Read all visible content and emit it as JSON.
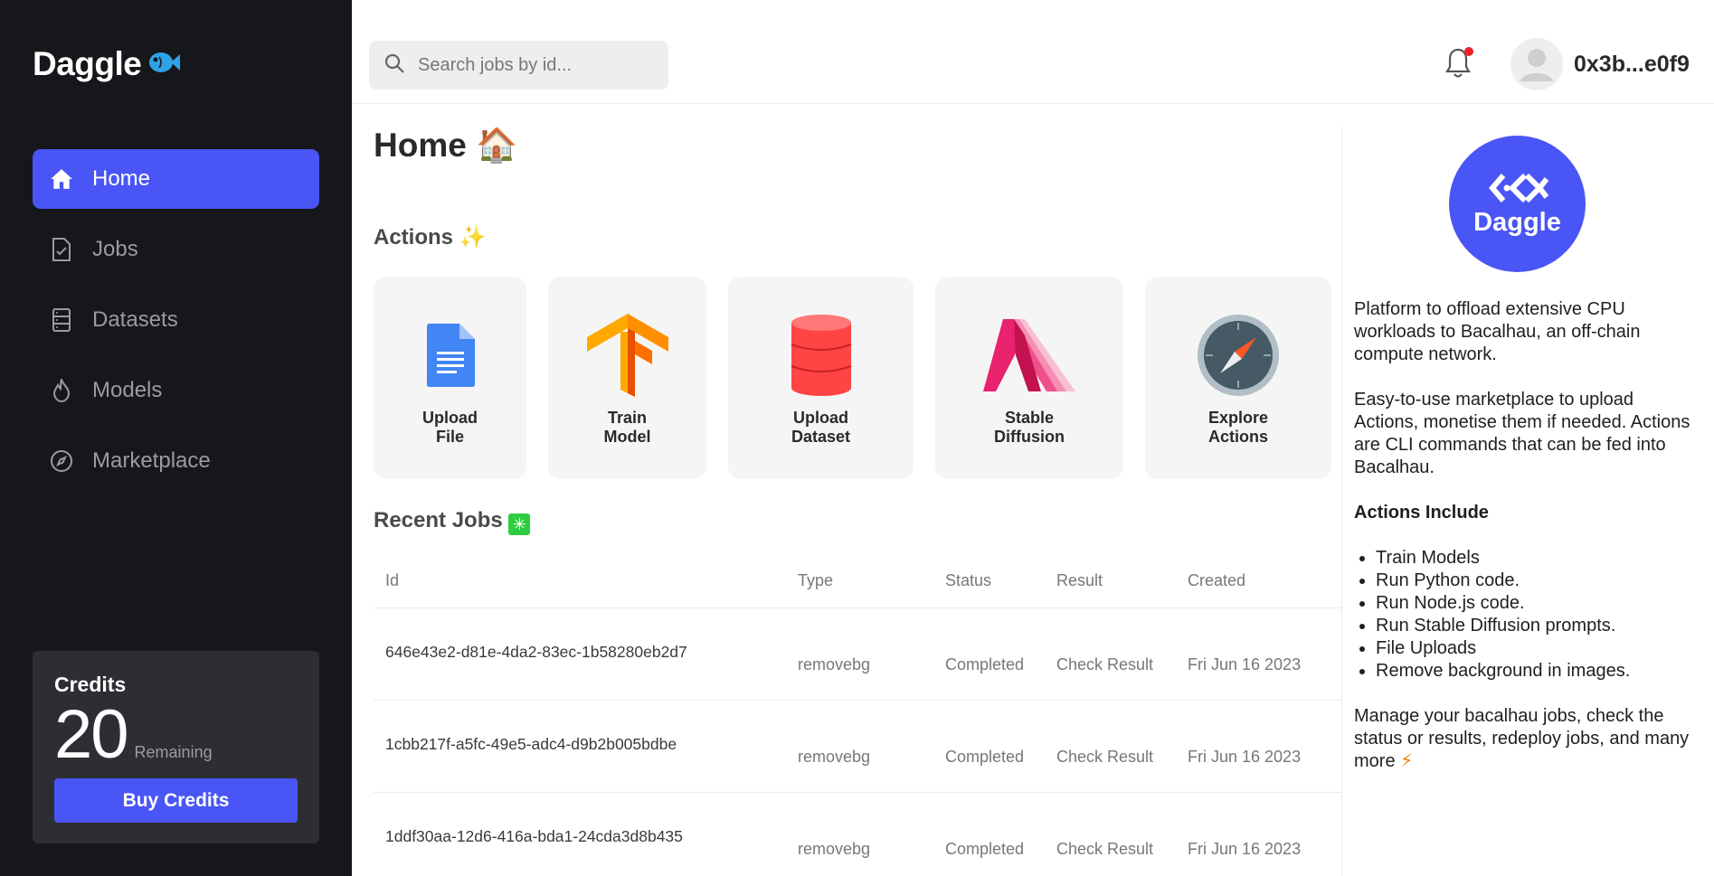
{
  "sidebar": {
    "logo": "Daggle",
    "nav": [
      {
        "label": "Home",
        "icon": "home-icon",
        "active": true
      },
      {
        "label": "Jobs",
        "icon": "file-check-icon",
        "active": false
      },
      {
        "label": "Datasets",
        "icon": "database-icon",
        "active": false
      },
      {
        "label": "Models",
        "icon": "flame-icon",
        "active": false
      },
      {
        "label": "Marketplace",
        "icon": "compass-icon",
        "active": false
      }
    ],
    "credits": {
      "title": "Credits",
      "amount": "20",
      "remaining_label": "Remaining",
      "buy_label": "Buy Credits"
    }
  },
  "header": {
    "search_placeholder": "Search jobs by id...",
    "user_address": "0x3b...e0f9",
    "notification_dot": true
  },
  "main": {
    "title": "Home",
    "title_emoji": "🏠",
    "actions_title": "Actions",
    "actions_emoji": "✨",
    "actions": [
      {
        "line1": "Upload",
        "line2": "File",
        "icon": "google-doc-icon"
      },
      {
        "line1": "Train",
        "line2": "Model",
        "icon": "tensorflow-icon"
      },
      {
        "line1": "Upload",
        "line2": "Dataset",
        "icon": "database-red-icon"
      },
      {
        "line1": "Stable",
        "line2": "Diffusion",
        "icon": "stable-diffusion-icon"
      },
      {
        "line1": "Explore",
        "line2": "Actions",
        "icon": "compass-safari-icon"
      }
    ],
    "recent_title": "Recent Jobs",
    "recent_emoji": "✳",
    "table": {
      "headers": [
        "Id",
        "Type",
        "Status",
        "Result",
        "Created"
      ],
      "rows": [
        {
          "id": "646e43e2-d81e-4da2-83ec-1b58280eb2d7",
          "type": "removebg",
          "status": "Completed",
          "result": "Check Result",
          "created": "Fri Jun 16 2023"
        },
        {
          "id": "1cbb217f-a5fc-49e5-adc4-d9b2b005bdbe",
          "type": "removebg",
          "status": "Completed",
          "result": "Check Result",
          "created": "Fri Jun 16 2023"
        },
        {
          "id": "1ddf30aa-12d6-416a-bda1-24cda3d8b435",
          "type": "removebg",
          "status": "Completed",
          "result": "Check Result",
          "created": "Fri Jun 16 2023"
        }
      ]
    }
  },
  "right_panel": {
    "badge_text": "Daggle",
    "para1": "Platform to offload extensive CPU workloads to Bacalhau, an off-chain compute network.",
    "para2": "Easy-to-use marketplace to upload Actions, monetise them if needed. Actions are CLI commands that can be fed into Bacalhau.",
    "list_title": "Actions Include",
    "list": [
      "Train Models",
      "Run Python code.",
      "Run Node.js code.",
      "Run Stable Diffusion prompts.",
      "File Uploads",
      "Remove background in images."
    ],
    "para3": "Manage your bacalhau jobs, check the status or results, redeploy jobs, and many more",
    "para3_emoji": "⚡"
  },
  "colors": {
    "accent": "#4a55f5",
    "sidebar_bg": "#16171b",
    "card_bg": "#f5f5f5"
  }
}
